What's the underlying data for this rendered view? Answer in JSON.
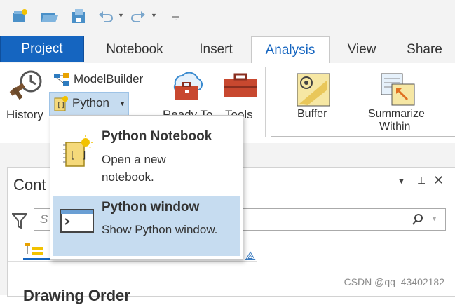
{
  "quick_access": {
    "items": [
      {
        "name": "new-project-icon"
      },
      {
        "name": "open-project-icon"
      },
      {
        "name": "save-project-icon"
      },
      {
        "name": "undo-icon"
      },
      {
        "name": "redo-icon"
      },
      {
        "name": "customize-qat-icon"
      }
    ]
  },
  "tabs": [
    "Project",
    "Notebook",
    "Insert",
    "Analysis",
    "View",
    "Share"
  ],
  "active_tab": "Analysis",
  "ribbon": {
    "history_label": "History",
    "modelbuilder_label": "ModelBuilder",
    "python_label": "Python",
    "ready_to_label": "Ready To",
    "tools_label": "Tools",
    "buffer_label": "Buffer",
    "summarize_label_line1": "Summarize",
    "summarize_label_line2": "Within"
  },
  "python_menu": {
    "items": [
      {
        "title": "Python Notebook",
        "description_line1": "Open a new",
        "description_line2": "notebook."
      },
      {
        "title": "Python window",
        "description": "Show Python window."
      }
    ]
  },
  "pane": {
    "title_partial": "Cont",
    "search_placeholder_partial": "S",
    "section_heading_partial": "Drawing Order"
  },
  "watermark": "CSDN @qq_43402182",
  "colors": {
    "accent": "#1565c0",
    "hover": "#c6dcf0",
    "project_tab": "#1565c0"
  }
}
